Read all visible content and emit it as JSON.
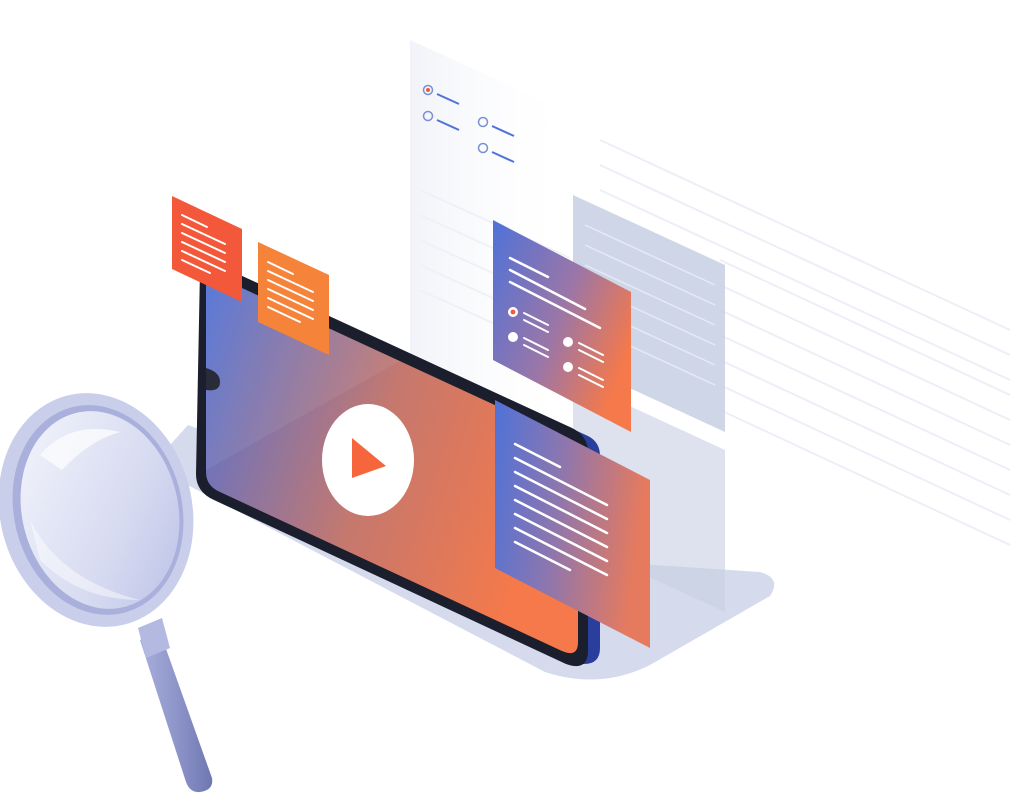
{
  "illustration": {
    "subject": "video-search-illustration",
    "colors": {
      "gradient_blue": "#4F72D8",
      "gradient_orange": "#F5794A",
      "note_red": "#F4583B",
      "note_orange": "#F5833A",
      "platform": "#D5DBEC",
      "phone_frame": "#1B1E2C",
      "ghost_panel": "#C7CFE3",
      "line_blue": "#4F72D8",
      "dot_orange": "#F4583B",
      "lens_rim": "#C9CEEA",
      "handle": "#8E95C9"
    },
    "icons": [
      "play-icon",
      "magnifier-icon",
      "radio-option-icon",
      "text-lines-icon"
    ]
  }
}
